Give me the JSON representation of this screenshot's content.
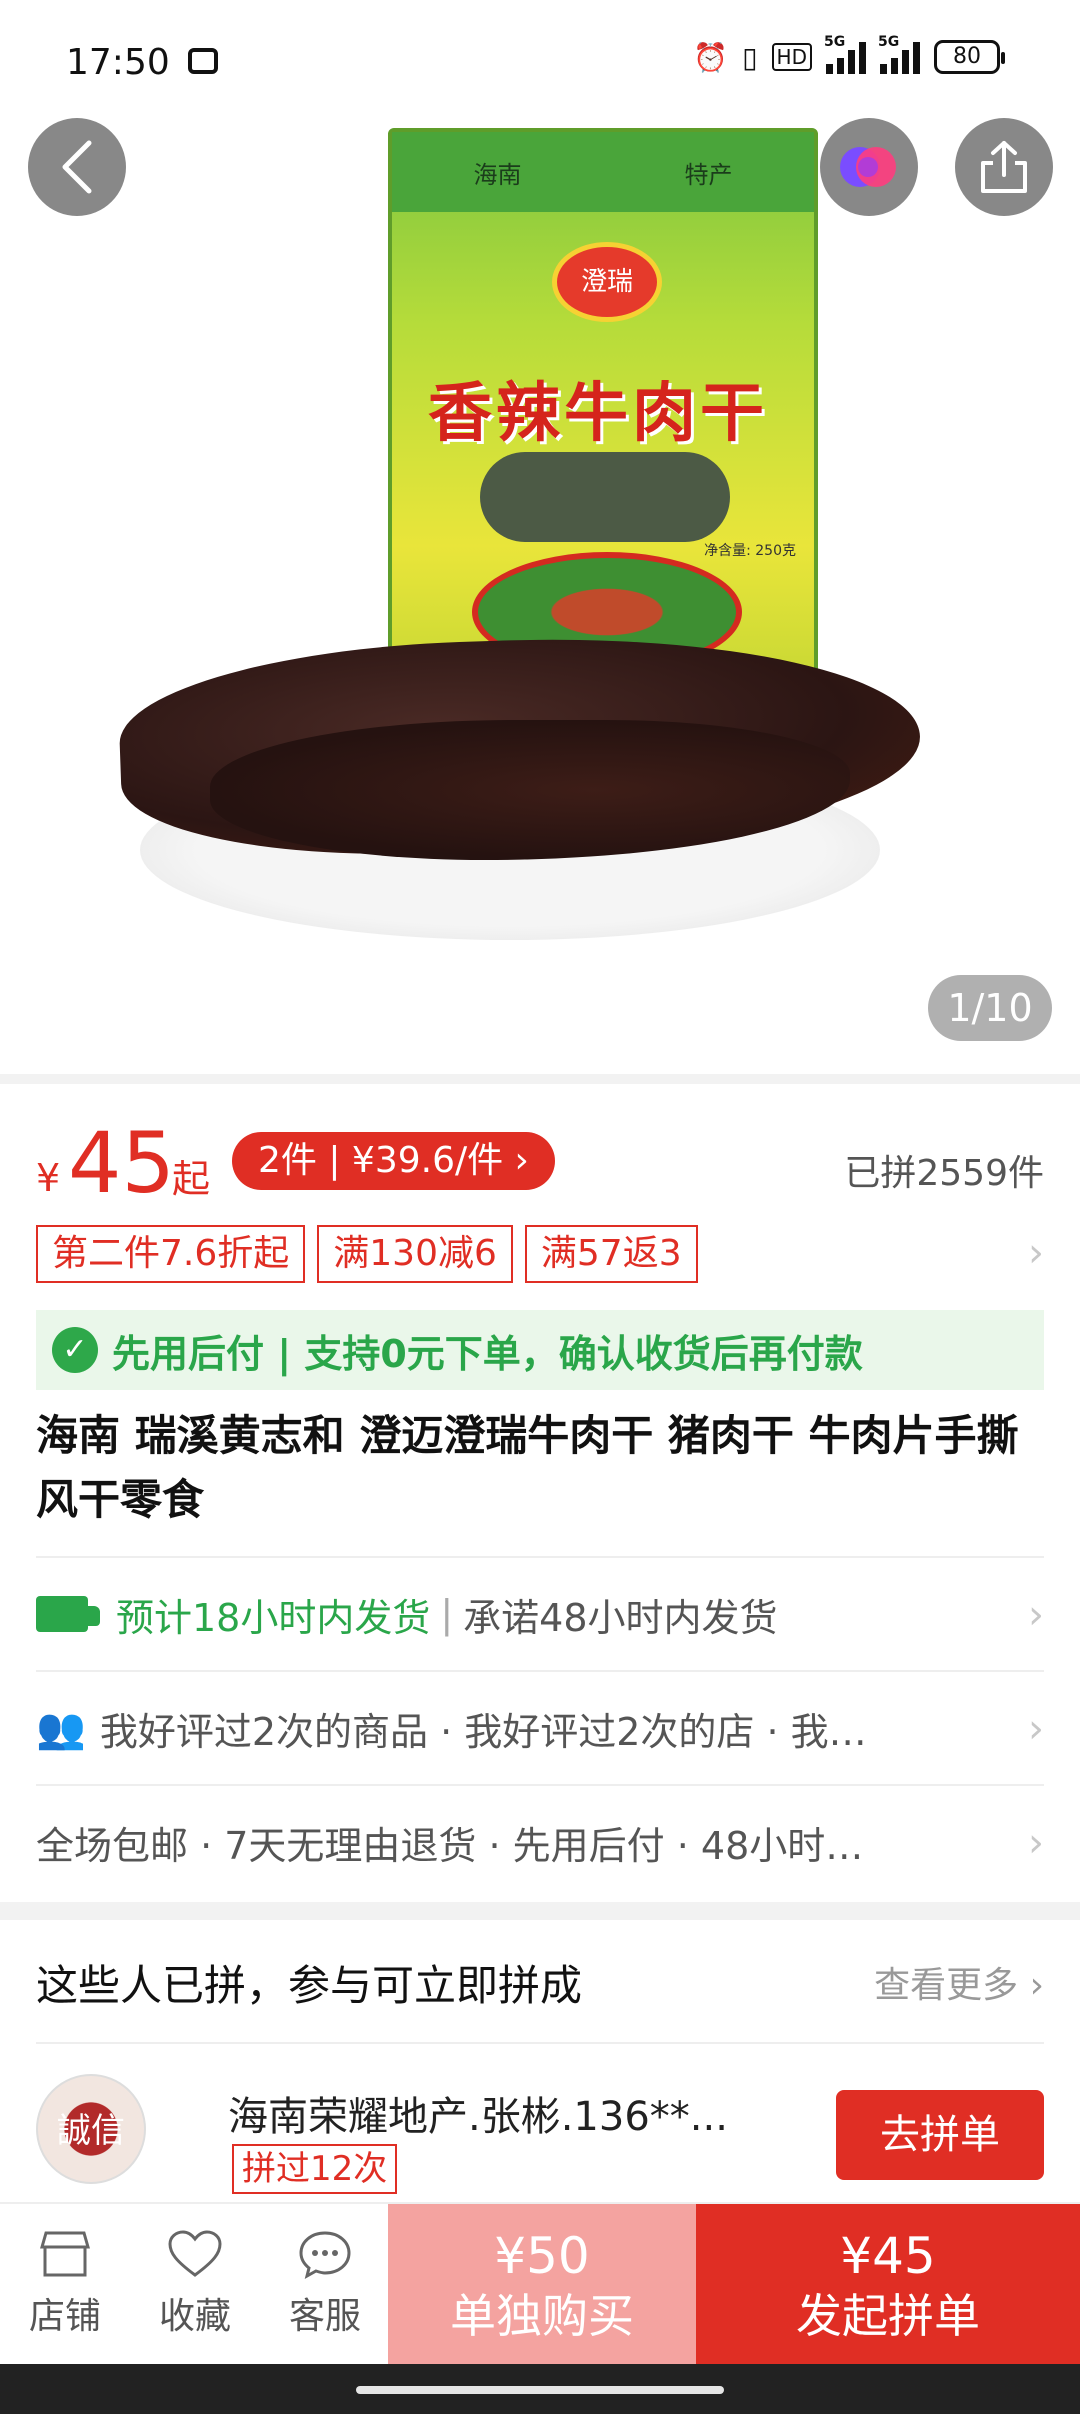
{
  "status_bar": {
    "time": "17:50",
    "network_type": "5G",
    "battery": "80"
  },
  "gallery": {
    "page_indicator": "1/10",
    "package": {
      "top_left": "海南",
      "top_right": "特产",
      "brand": "澄瑞",
      "title": "香辣牛肉干",
      "weight": "净含量: 250克"
    }
  },
  "price": {
    "currency": "¥",
    "amount": "45",
    "suffix": "起",
    "group_deal": "2件 | ¥39.6/件 ›",
    "sold": "已拼2559件"
  },
  "promos": [
    "第二件7.6折起",
    "满130减6",
    "满57返3"
  ],
  "pay_later": "先用后付 | 支持0元下单，确认收货后再付款",
  "product_title": "海南 瑞溪黄志和 澄迈澄瑞牛肉干 猪肉干 牛肉片手撕风干零食",
  "shipping": {
    "estimate": "预计18小时内发货",
    "promise": "承诺48小时内发货"
  },
  "reviews_row": "我好评过2次的商品 · 我好评过2次的店 · 我…",
  "services_row": "全场包邮 · 7天无理由退货 · 先用后付 · 48小时…",
  "group": {
    "title": "这些人已拼，参与可立即拼成",
    "view_more": "查看更多 ›",
    "avatar_text": "誠信",
    "user_name": "海南荣耀地产.张彬.136**...",
    "badge": "拼过12次",
    "join_button": "去拼单"
  },
  "bottom_bar": {
    "store": "店铺",
    "favorite": "收藏",
    "service": "客服",
    "single_price": "¥50",
    "single_label": "单独购买",
    "group_price": "¥45",
    "group_label": "发起拼单"
  },
  "colors": {
    "accent_red": "#e02e24",
    "green": "#2aa64a",
    "single_buy_bg": "#f4a3a0"
  }
}
